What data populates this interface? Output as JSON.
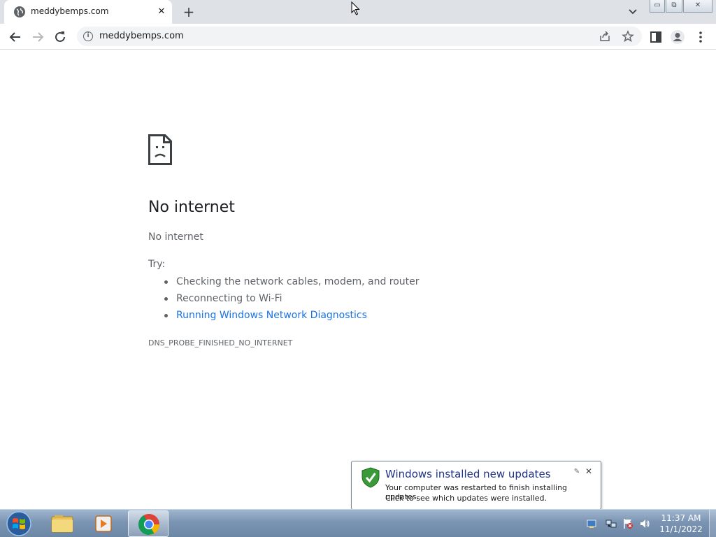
{
  "browser": {
    "tab": {
      "title": "meddybemps.com",
      "close_glyph": "✕"
    },
    "newtab_glyph": "+",
    "window_controls": {
      "minimize": "▭",
      "restore": "⧉",
      "close": "✕"
    },
    "url": "meddybemps.com",
    "icons": [
      "back-arrow-icon",
      "forward-arrow-icon",
      "reload-icon",
      "info-icon",
      "share-icon",
      "star-icon",
      "side-panel-icon",
      "profile-icon",
      "menu-icon"
    ]
  },
  "error_page": {
    "heading": "No internet",
    "subtext": "No internet",
    "try_label": "Try:",
    "suggestions": [
      "Checking the network cables, modem, and router",
      "Reconnecting to Wi-Fi",
      "Running Windows Network Diagnostics"
    ],
    "error_code": "DNS_PROBE_FINISHED_NO_INTERNET"
  },
  "notification": {
    "title": "Windows installed new updates",
    "line1": "Your computer was restarted to finish installing updates.",
    "line2": "Click to see which updates were installed.",
    "close_glyph": "✕",
    "options_glyph": "✎"
  },
  "taskbar": {
    "apps": [
      "file-explorer-icon",
      "media-player-icon",
      "chrome-icon"
    ],
    "clock_time": "11:37 AM",
    "clock_date": "11/1/2022"
  },
  "colors": {
    "link": "#1a73e8",
    "notification_title": "#1e3287",
    "tabstrip": "#dee1e6"
  }
}
